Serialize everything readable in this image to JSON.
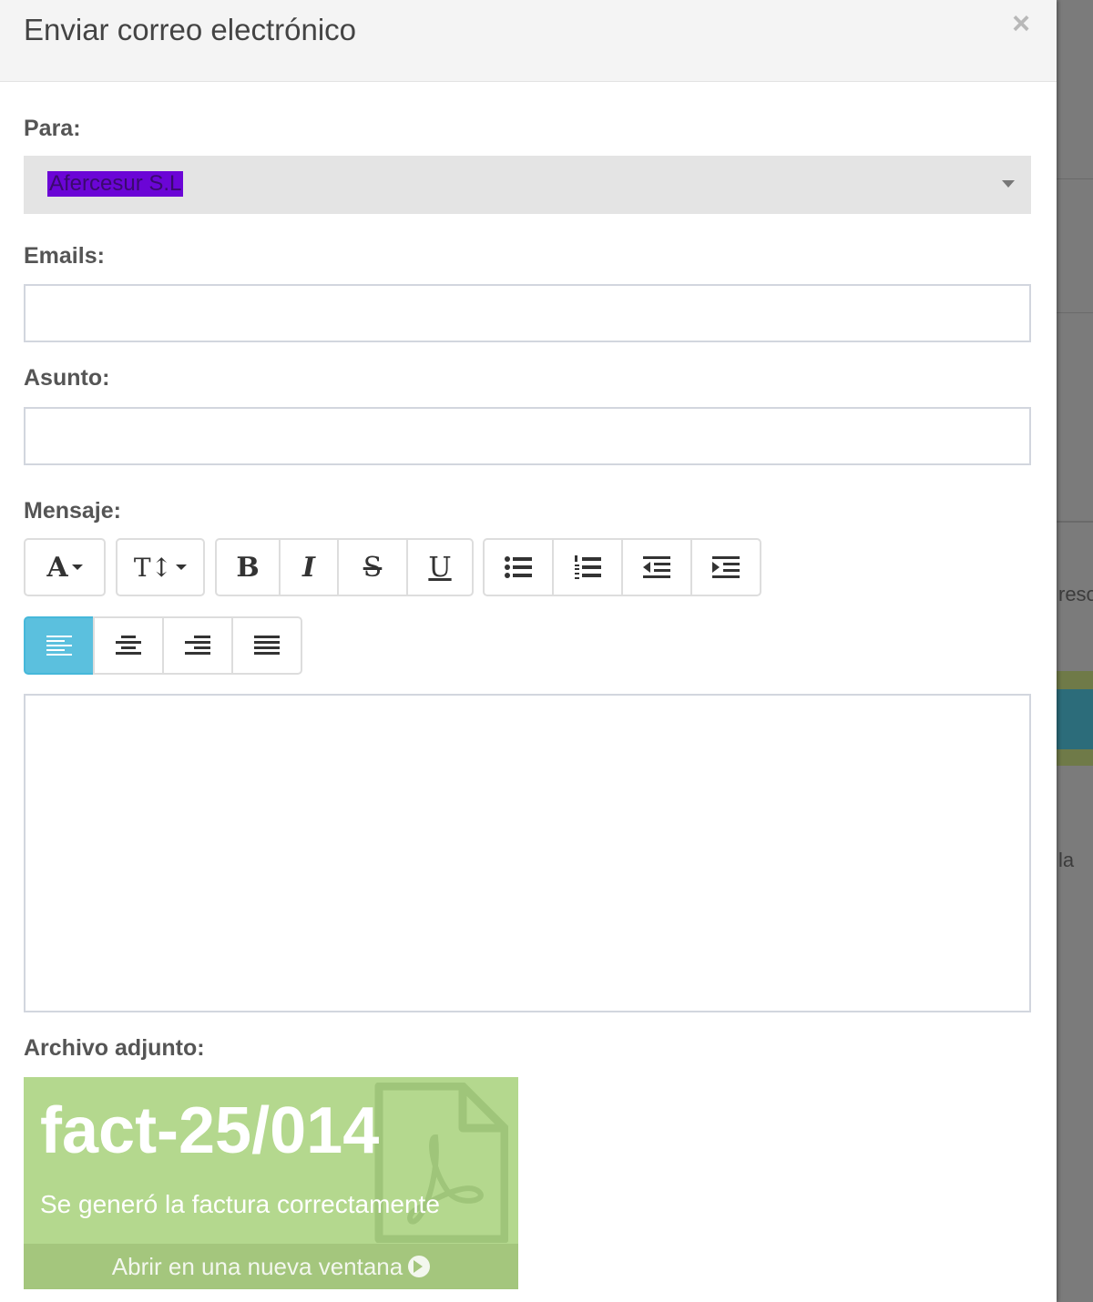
{
  "modal": {
    "title": "Enviar correo electrónico",
    "close_label": "×"
  },
  "form": {
    "to_label": "Para:",
    "to_value": "Afercesur S.L",
    "emails_label": "Emails:",
    "emails_value": "",
    "subject_label": "Asunto:",
    "subject_value": "",
    "message_label": "Mensaje:",
    "attachment_label": "Archivo adjunto:"
  },
  "toolbar": {
    "font": "A",
    "font_size": "T↕",
    "bold": "B",
    "italic": "I",
    "strike": "S",
    "underline": "U",
    "alignment_active": "left"
  },
  "attachment": {
    "name": "fact-25/014",
    "description": "Se generó la factura correctamente",
    "open_link": "Abrir en una nueva ventana",
    "icon": "file-pdf-icon"
  },
  "background": {
    "text_1": "reso",
    "text_2": "la"
  },
  "colors": {
    "active_button": "#5bc0de",
    "attachment_bg": "#b4d88e",
    "attachment_footer": "#a4c67d",
    "selection_highlight": "#6b05d6"
  }
}
